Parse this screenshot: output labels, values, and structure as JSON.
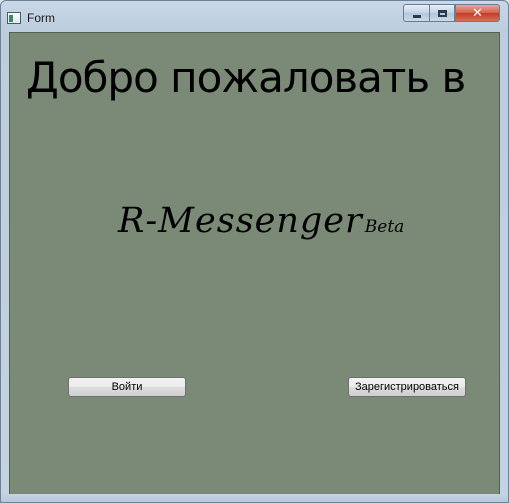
{
  "window": {
    "title": "Form"
  },
  "main": {
    "welcome_text": "Добро пожаловать в",
    "brand_name": "R-Messenger",
    "brand_suffix": "Beta"
  },
  "buttons": {
    "login_label": "Войти",
    "register_label": "Зарегистрироваться"
  },
  "colors": {
    "client_background": "#7b8a76",
    "close_button": "#c33c24"
  }
}
